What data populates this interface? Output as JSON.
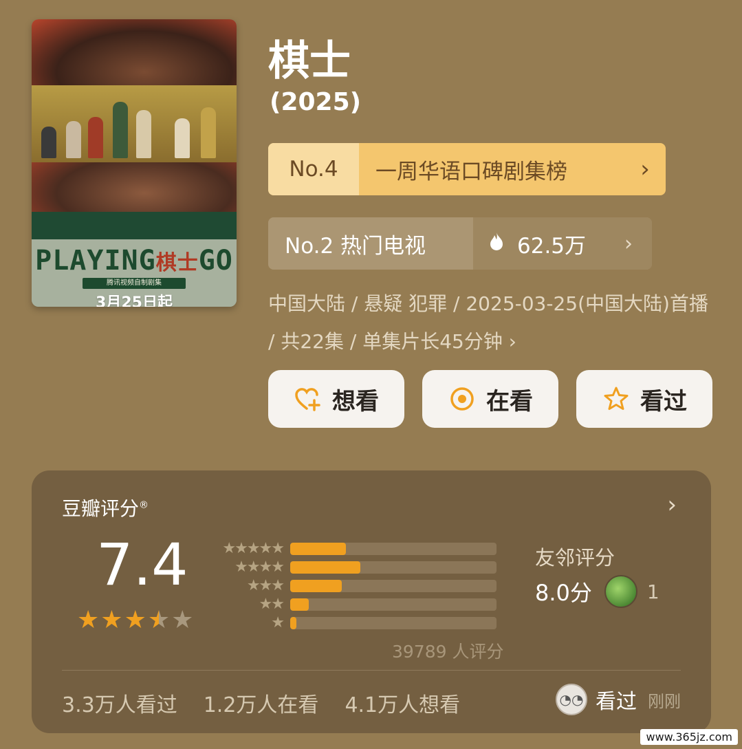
{
  "poster": {
    "title_en_a": "PLAYING",
    "title_cn": "棋士",
    "title_en_b": "GO",
    "strip_text": "腾讯视频自制剧集",
    "date_text": "3月25日起"
  },
  "show": {
    "title": "棋士",
    "year": "(2025)"
  },
  "rank_primary": {
    "no": "No.4",
    "label": "一周华语口碑剧集榜",
    "chevron": "›"
  },
  "rank_secondary": {
    "label": "No.2 热门电视",
    "heat": "62.5万",
    "chevron": "›"
  },
  "meta": {
    "text": "中国大陆 / 悬疑 犯罪 / 2025-03-25(中国大陆)首播 / 共22集 / 单集片长45分钟",
    "chevron": "›"
  },
  "actions": [
    {
      "label": "想看",
      "icon": "heart-plus-icon"
    },
    {
      "label": "在看",
      "icon": "target-icon"
    },
    {
      "label": "看过",
      "icon": "star-outline-icon"
    }
  ],
  "rating": {
    "title": "豆瓣评分",
    "reg": "®",
    "chevron": "›",
    "score": "7.4",
    "stars_value": 3.5,
    "stars_max": 5,
    "distribution": [
      {
        "stars": "★★★★★",
        "fraction": 0.27
      },
      {
        "stars": "★★★★",
        "fraction": 0.34
      },
      {
        "stars": "★★★",
        "fraction": 0.25
      },
      {
        "stars": "★★",
        "fraction": 0.09
      },
      {
        "stars": "★",
        "fraction": 0.03
      }
    ],
    "votes": "39789 人评分",
    "friend_label": "友邻评分",
    "friend_score": "8.0分",
    "friend_count": "1",
    "stats": [
      "3.3万人看过",
      "1.2万人在看",
      "4.1万人想看"
    ],
    "recent_action": "看过",
    "recent_time": "刚刚"
  },
  "colors": {
    "background": "#957c52",
    "accent": "#f0a020",
    "panel": "#745f41"
  },
  "watermark": "www.365jz.com"
}
